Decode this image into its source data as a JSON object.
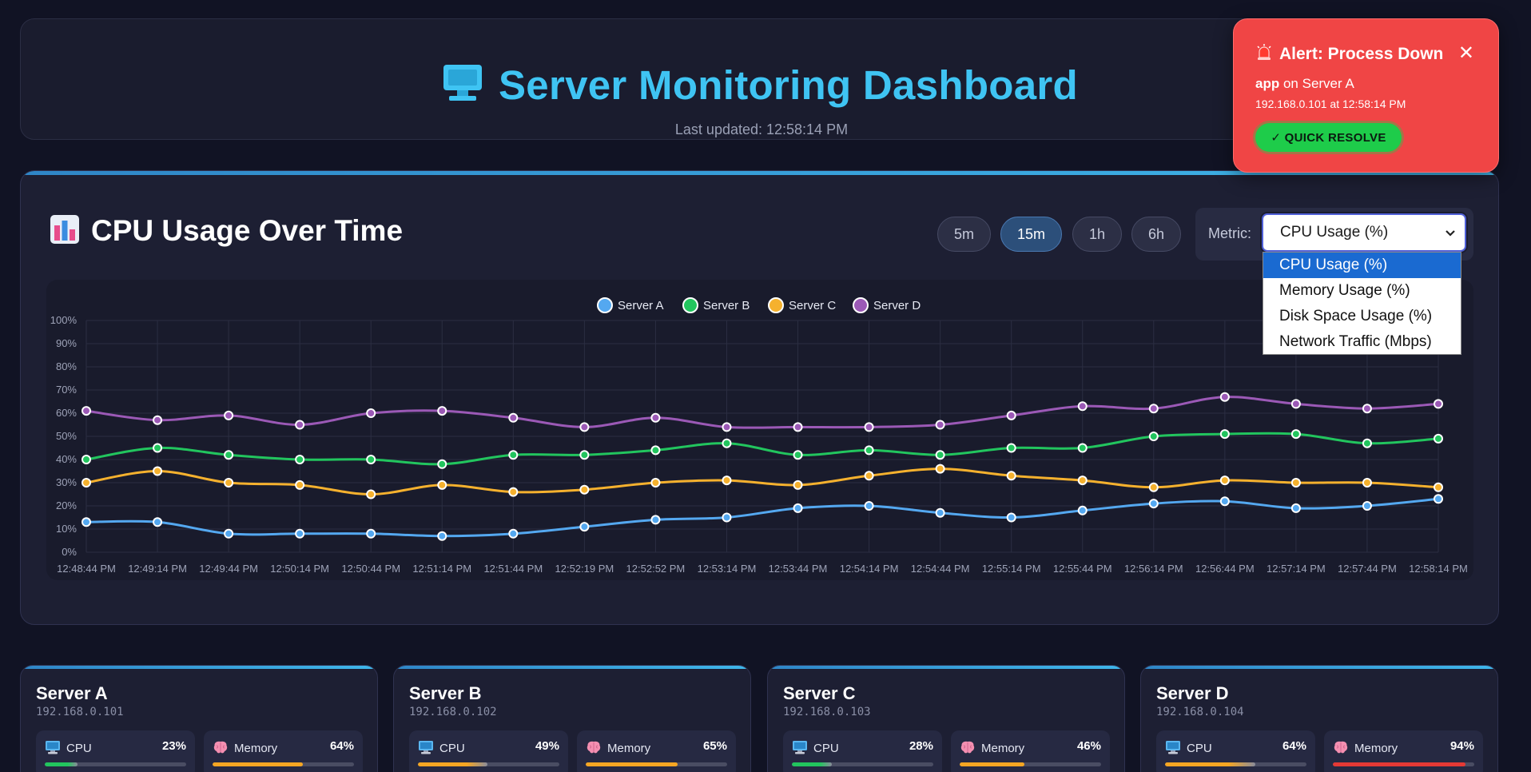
{
  "header": {
    "title": "Server Monitoring Dashboard",
    "icon": "monitor-icon",
    "updated_label": "Last updated:",
    "updated_time": "12:58:14 PM"
  },
  "chart_panel": {
    "title": "CPU Usage Over Time",
    "icon": "bar-chart-icon",
    "ranges": [
      {
        "label": "5m",
        "active": false
      },
      {
        "label": "15m",
        "active": true
      },
      {
        "label": "1h",
        "active": false
      },
      {
        "label": "6h",
        "active": false
      }
    ],
    "metric_label": "Metric:",
    "metric_selected": "CPU Usage (%)",
    "metric_options": [
      "CPU Usage (%)",
      "Memory Usage (%)",
      "Disk Space Usage (%)",
      "Network Traffic (Mbps)"
    ]
  },
  "chart_data": {
    "type": "line",
    "title": "",
    "xlabel": "",
    "ylabel": "",
    "legend_position": "top-center",
    "grid": true,
    "ylim": [
      0,
      100
    ],
    "y_ticks": [
      "0%",
      "10%",
      "20%",
      "30%",
      "40%",
      "50%",
      "60%",
      "70%",
      "80%",
      "90%",
      "100%"
    ],
    "x": [
      "12:48:44 PM",
      "12:49:14 PM",
      "12:49:44 PM",
      "12:50:14 PM",
      "12:50:44 PM",
      "12:51:14 PM",
      "12:51:44 PM",
      "12:52:19 PM",
      "12:52:52 PM",
      "12:53:14 PM",
      "12:53:44 PM",
      "12:54:14 PM",
      "12:54:44 PM",
      "12:55:14 PM",
      "12:55:44 PM",
      "12:56:14 PM",
      "12:56:44 PM",
      "12:57:14 PM",
      "12:57:44 PM",
      "12:58:14 PM"
    ],
    "series": [
      {
        "name": "Server A",
        "color": "#54a8f0",
        "values": [
          13,
          13,
          8,
          8,
          8,
          7,
          8,
          11,
          14,
          15,
          19,
          20,
          17,
          15,
          18,
          21,
          22,
          19,
          20,
          23
        ]
      },
      {
        "name": "Server B",
        "color": "#22c55e",
        "values": [
          40,
          45,
          42,
          40,
          40,
          38,
          42,
          42,
          44,
          47,
          42,
          44,
          42,
          45,
          45,
          50,
          51,
          51,
          47,
          49
        ]
      },
      {
        "name": "Server C",
        "color": "#f5b12e",
        "values": [
          30,
          35,
          30,
          29,
          25,
          29,
          26,
          27,
          30,
          31,
          29,
          33,
          36,
          33,
          31,
          28,
          31,
          30,
          30,
          28
        ]
      },
      {
        "name": "Server D",
        "color": "#9b59b6",
        "values": [
          61,
          57,
          59,
          55,
          60,
          61,
          58,
          54,
          58,
          54,
          54,
          54,
          55,
          59,
          63,
          62,
          67,
          64,
          62,
          64
        ]
      }
    ]
  },
  "alert": {
    "title": "Alert: Process Down",
    "icon": "siren-icon",
    "close": "✕",
    "process": "app",
    "on_text": "on Server A",
    "details": "192.168.0.101 at 12:58:14 PM",
    "button": "✓ QUICK RESOLVE"
  },
  "servers": [
    {
      "name": "Server A",
      "ip": "192.168.0.101",
      "cpu": {
        "label": "CPU",
        "value": "23%",
        "fraction": 0.23,
        "color": "#22c55e"
      },
      "memory": {
        "label": "Memory",
        "value": "64%",
        "fraction": 0.64,
        "color": "#f5a623"
      }
    },
    {
      "name": "Server B",
      "ip": "192.168.0.102",
      "cpu": {
        "label": "CPU",
        "value": "49%",
        "fraction": 0.49,
        "color": "#f5a623"
      },
      "memory": {
        "label": "Memory",
        "value": "65%",
        "fraction": 0.65,
        "color": "#f5a623"
      }
    },
    {
      "name": "Server C",
      "ip": "192.168.0.103",
      "cpu": {
        "label": "CPU",
        "value": "28%",
        "fraction": 0.28,
        "color": "#22c55e"
      },
      "memory": {
        "label": "Memory",
        "value": "46%",
        "fraction": 0.46,
        "color": "#f5a623"
      }
    },
    {
      "name": "Server D",
      "ip": "192.168.0.104",
      "cpu": {
        "label": "CPU",
        "value": "64%",
        "fraction": 0.64,
        "color": "#f5a623"
      },
      "memory": {
        "label": "Memory",
        "value": "94%",
        "fraction": 0.94,
        "color": "#e53935"
      }
    }
  ]
}
